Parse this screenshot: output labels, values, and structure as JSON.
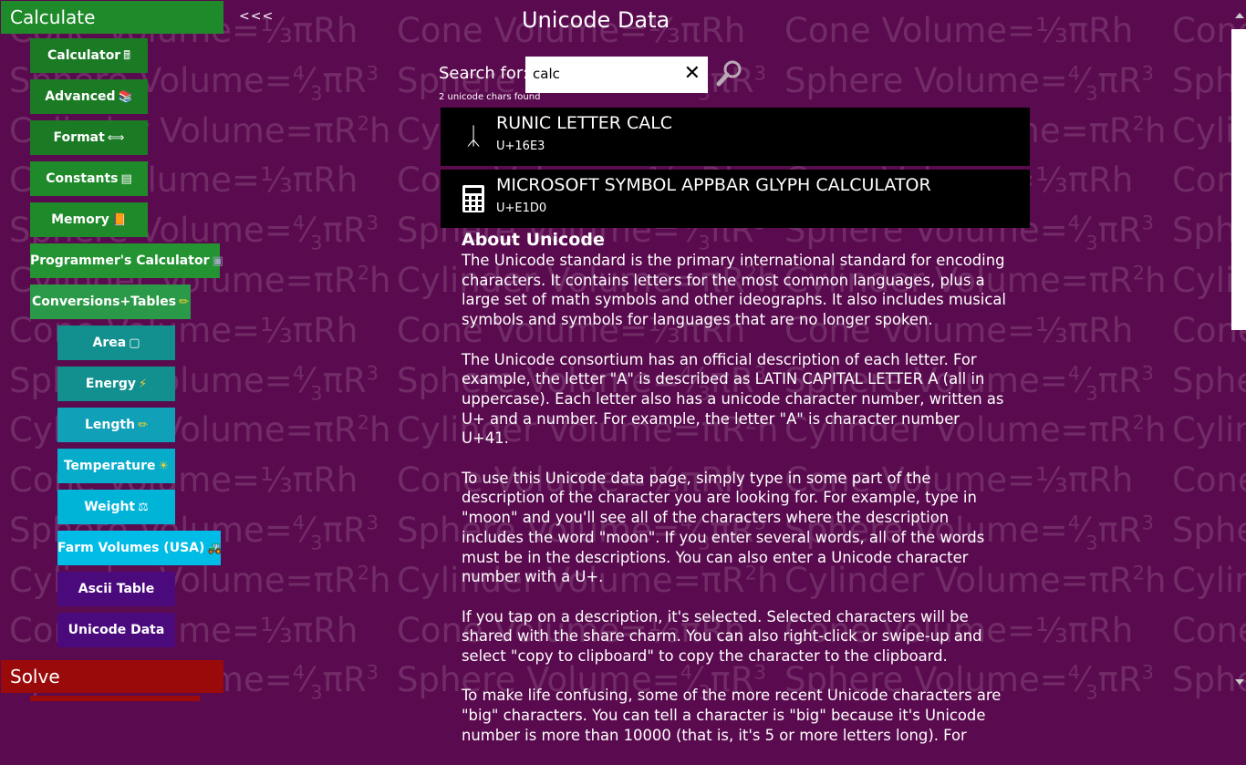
{
  "watermark": {
    "cone": "Cone Volume=⅓πRh",
    "sphere_pre": "Sphere Volume=",
    "sphere_frac": "4/3",
    "sphere_post": "πR",
    "sphere_exp": "3",
    "cyl_pre": "Cylinder Volume=πR",
    "cyl_exp": "2",
    "cyl_post": "h"
  },
  "nav": {
    "calculate": "Calculate",
    "collapse": "<<<",
    "solve": "Solve",
    "items": [
      {
        "label": "Calculator",
        "icon": "🖩"
      },
      {
        "label": "Advanced",
        "icon": "📚"
      },
      {
        "label": "Format",
        "icon": "⟺"
      },
      {
        "label": "Constants",
        "icon": "▤"
      },
      {
        "label": "Memory",
        "icon": "📙"
      },
      {
        "label": "Programmer's Calculator",
        "icon": "▣"
      },
      {
        "label": "Conversions+Tables",
        "icon": "✏"
      },
      {
        "label": "Area",
        "icon": "▢"
      },
      {
        "label": "Energy",
        "icon": "⚡"
      },
      {
        "label": "Length",
        "icon": "✏"
      },
      {
        "label": "Temperature",
        "icon": "☀"
      },
      {
        "label": "Weight",
        "icon": "⚖"
      },
      {
        "label": "Farm Volumes (USA)",
        "icon": "🚜"
      },
      {
        "label": "Ascii Table",
        "icon": ""
      },
      {
        "label": "Unicode Data",
        "icon": ""
      }
    ]
  },
  "colors": {
    "background": "#5a0a4e",
    "nav_green": "#1f8a2a",
    "nav_teal": "#12908f",
    "nav_cyan": "#00b4d8",
    "nav_purple": "#4b0a7c",
    "solve_red": "#9a0a0a"
  },
  "page": {
    "title": "Unicode Data",
    "search_label": "Search for:",
    "search_value": "calc",
    "found_text": "2 unicode chars found"
  },
  "results": [
    {
      "glyph": "ᛣ",
      "name": "RUNIC LETTER CALC",
      "code": "U+16E3"
    },
    {
      "glyph": "calculator-icon",
      "name": "MICROSOFT SYMBOL APPBAR GLYPH CALCULATOR",
      "code": "U+E1D0"
    }
  ],
  "about": {
    "heading": "About Unicode",
    "paragraphs": [
      "The Unicode standard is the primary international standard for encoding characters. It contains letters for the most common languages, plus a large set of math symbols and other ideographs. It also includes musical symbols and symbols for languages that are no longer spoken.",
      "The Unicode consortium has an official description of each letter. For example, the letter \"A\" is described as LATIN CAPITAL LETTER A (all in uppercase). Each letter also has a unicode character number, written as U+ and a number. For example, the letter \"A\" is character number U+41.",
      "To use this Unicode data page, simply type in some part of the description of the character you are looking for. For example, type in \"moon\" and you'll see all of the characters where the description includes the word \"moon\". If you enter several words, all of the words must be in the descriptions. You can also enter a Unicode character number with a U+.",
      "If you tap on a description, it's selected. Selected characters will be shared with the share charm. You can also right-click or swipe-up and select \"copy to clipboard\" to copy the character to the clipboard.",
      "To make life confusing, some of the more recent Unicode characters are \"big\" characters. You can tell a character is \"big\" because it's Unicode number is more than 10000 (that is, it's 5 or more letters long). For"
    ]
  }
}
